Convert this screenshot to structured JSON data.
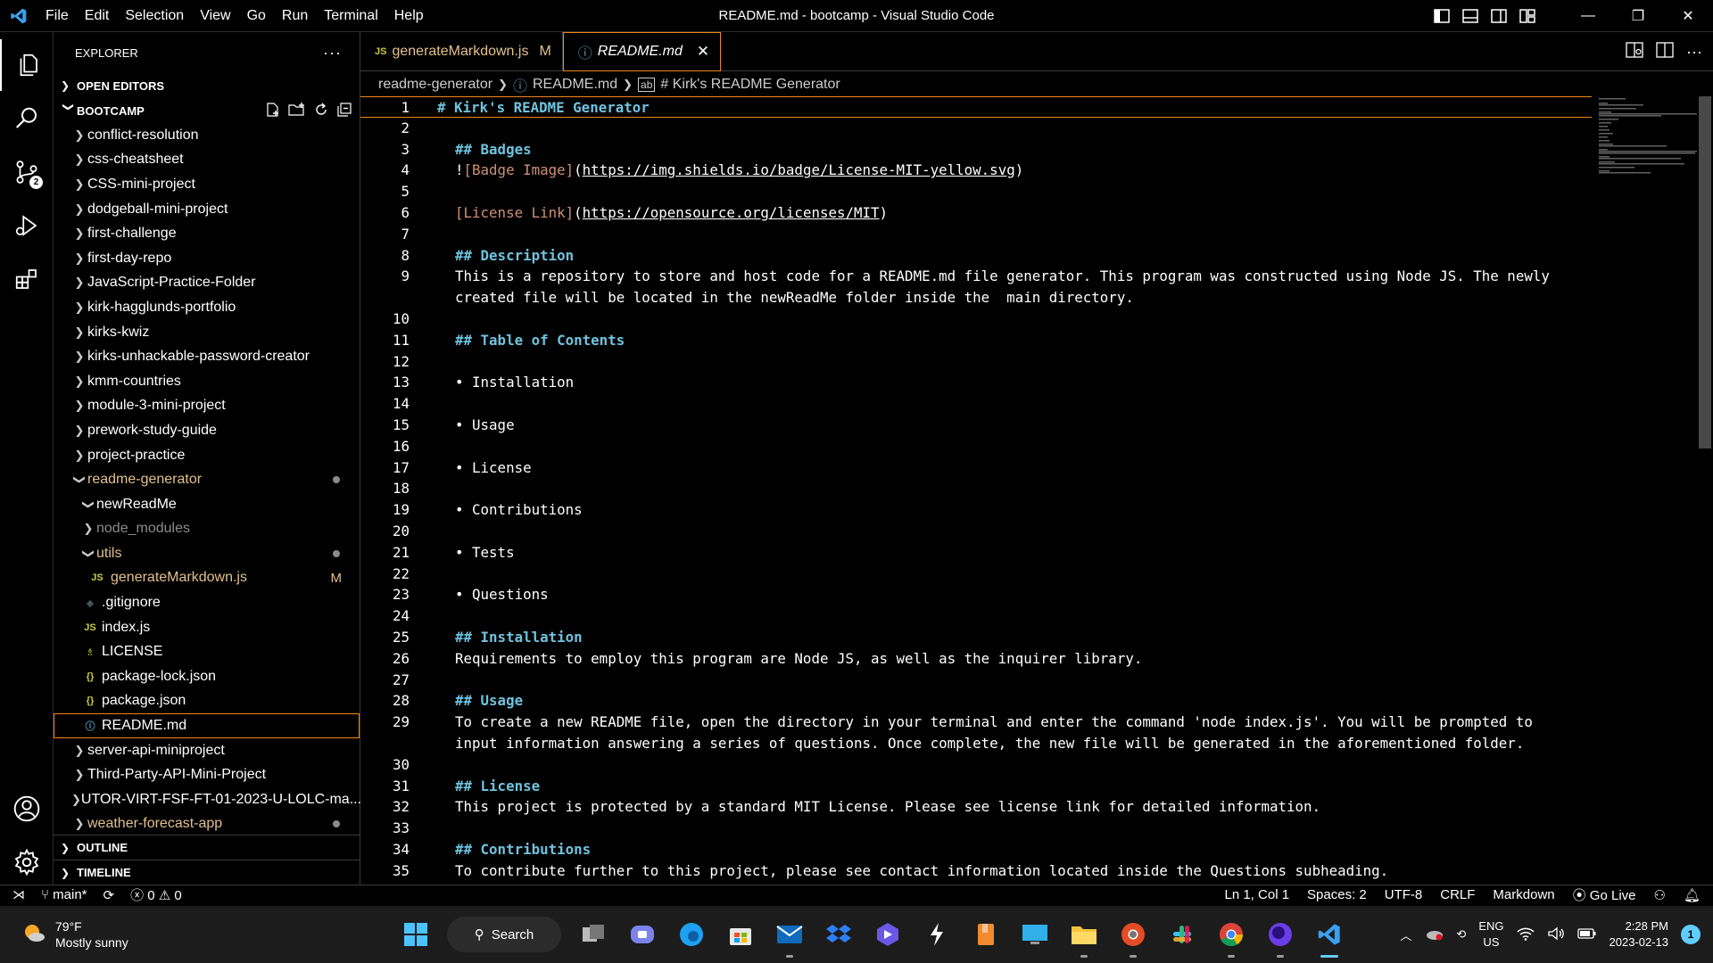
{
  "titlebar": {
    "menu": [
      "File",
      "Edit",
      "Selection",
      "View",
      "Go",
      "Run",
      "Terminal",
      "Help"
    ],
    "title": "README.md - bootcamp - Visual Studio Code"
  },
  "explorer": {
    "title": "EXPLORER",
    "open_editors": "OPEN EDITORS",
    "workspace": "BOOTCAMP",
    "tree": [
      "conflict-resolution",
      "css-cheatsheet",
      "CSS-mini-project",
      "dodgeball-mini-project",
      "first-challenge",
      "first-day-repo",
      "JavaScript-Practice-Folder",
      "kirk-hagglunds-portfolio",
      "kirks-kwiz",
      "kirks-unhackable-password-creator",
      "kmm-countries",
      "module-3-mini-project",
      "prework-study-guide",
      "project-practice"
    ],
    "readme_generator": "readme-generator",
    "new_readme": "newReadMe",
    "node_modules": "node_modules",
    "utils": "utils",
    "generate_markdown": "generateMarkdown.js",
    "generate_markdown_status": "M",
    "gitignore": ".gitignore",
    "index_js": "index.js",
    "license": "LICENSE",
    "package_lock": "package-lock.json",
    "package_json": "package.json",
    "readme": "README.md",
    "tree_after": [
      "server-api-miniproject",
      "Third-Party-API-Mini-Project",
      "UTOR-VIRT-FSF-FT-01-2023-U-LOLC-ma..."
    ],
    "weather_app": "weather-forecast-app",
    "outline": "OUTLINE",
    "timeline": "TIMELINE"
  },
  "tabs": {
    "tab1_label": "generateMarkdown.js",
    "tab1_status": "M",
    "tab2_label": "README.md"
  },
  "breadcrumb": {
    "folder": "readme-generator",
    "file": "README.md",
    "symbol": "# Kirk's README Generator"
  },
  "code": {
    "l1": "# Kirk's README Generator",
    "l3": "## Badges",
    "l4_bang": "!",
    "l4_text": "[Badge Image]",
    "l4_url": "https://img.shields.io/badge/License-MIT-yellow.svg",
    "l6_text": "[License Link]",
    "l6_url": "https://opensource.org/licenses/MIT",
    "l8": "## Description",
    "l9a": "This is a repository to store and host code for a README.md file generator. This program was constructed using Node JS. The newly",
    "l9b": "created file will be located in the newReadMe folder inside the  main directory.",
    "l11": "## Table of Contents",
    "l13": "• Installation",
    "l15": "• Usage",
    "l17": "• License",
    "l19": "• Contributions",
    "l21": "• Tests",
    "l23": "• Questions",
    "l25": "## Installation",
    "l26": "Requirements to employ this program are Node JS, as well as the inquirer library.",
    "l28": "## Usage",
    "l29a": "To create a new README file, open the directory in your terminal and enter the command 'node index.js'. You will be prompted to",
    "l29b": "input information answering a series of questions. Once complete, the new file will be generated in the aforementioned folder.",
    "l31": "## License",
    "l32": "This project is protected by a standard MIT License. Please see license link for detailed information.",
    "l34": "## Contributions",
    "l35": "To contribute further to this project, please see contact information located inside the Questions subheading."
  },
  "statusbar": {
    "branch": "main*",
    "errors": "0",
    "warnings": "0",
    "position": "Ln 1, Col 1",
    "spaces": "Spaces: 2",
    "encoding": "UTF-8",
    "eol": "CRLF",
    "language": "Markdown",
    "golive": "Go Live"
  },
  "taskbar": {
    "temp": "79°F",
    "weather": "Mostly sunny",
    "search": "Search",
    "lang1": "ENG",
    "lang2": "US",
    "time": "2:28 PM",
    "date": "2023-02-13",
    "notifications": "1"
  },
  "badges": {
    "source_control": "2"
  }
}
